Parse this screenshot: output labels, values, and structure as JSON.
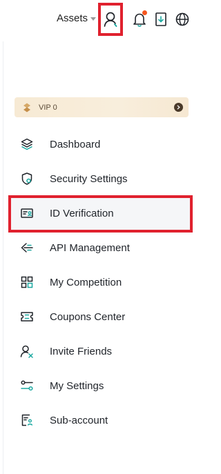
{
  "header": {
    "assets_label": "Assets"
  },
  "icons": {
    "user": "user-icon",
    "bell": "bell-icon",
    "download": "download-icon",
    "globe": "globe-icon"
  },
  "colors": {
    "highlight": "#e0212e",
    "notification_dot": "#f5561f",
    "accent_teal": "#1aa8a0"
  },
  "vip": {
    "label": "VIP 0"
  },
  "menu": {
    "items": [
      {
        "label": "Dashboard",
        "icon": "layers-icon"
      },
      {
        "label": "Security Settings",
        "icon": "shield-icon"
      },
      {
        "label": "ID Verification",
        "icon": "id-card-icon",
        "active": true
      },
      {
        "label": "API Management",
        "icon": "api-icon"
      },
      {
        "label": "My Competition",
        "icon": "grid-icon"
      },
      {
        "label": "Coupons Center",
        "icon": "coupon-icon"
      },
      {
        "label": "Invite Friends",
        "icon": "invite-user-icon"
      },
      {
        "label": "My Settings",
        "icon": "sliders-icon"
      },
      {
        "label": "Sub-account",
        "icon": "sub-account-icon"
      }
    ]
  }
}
